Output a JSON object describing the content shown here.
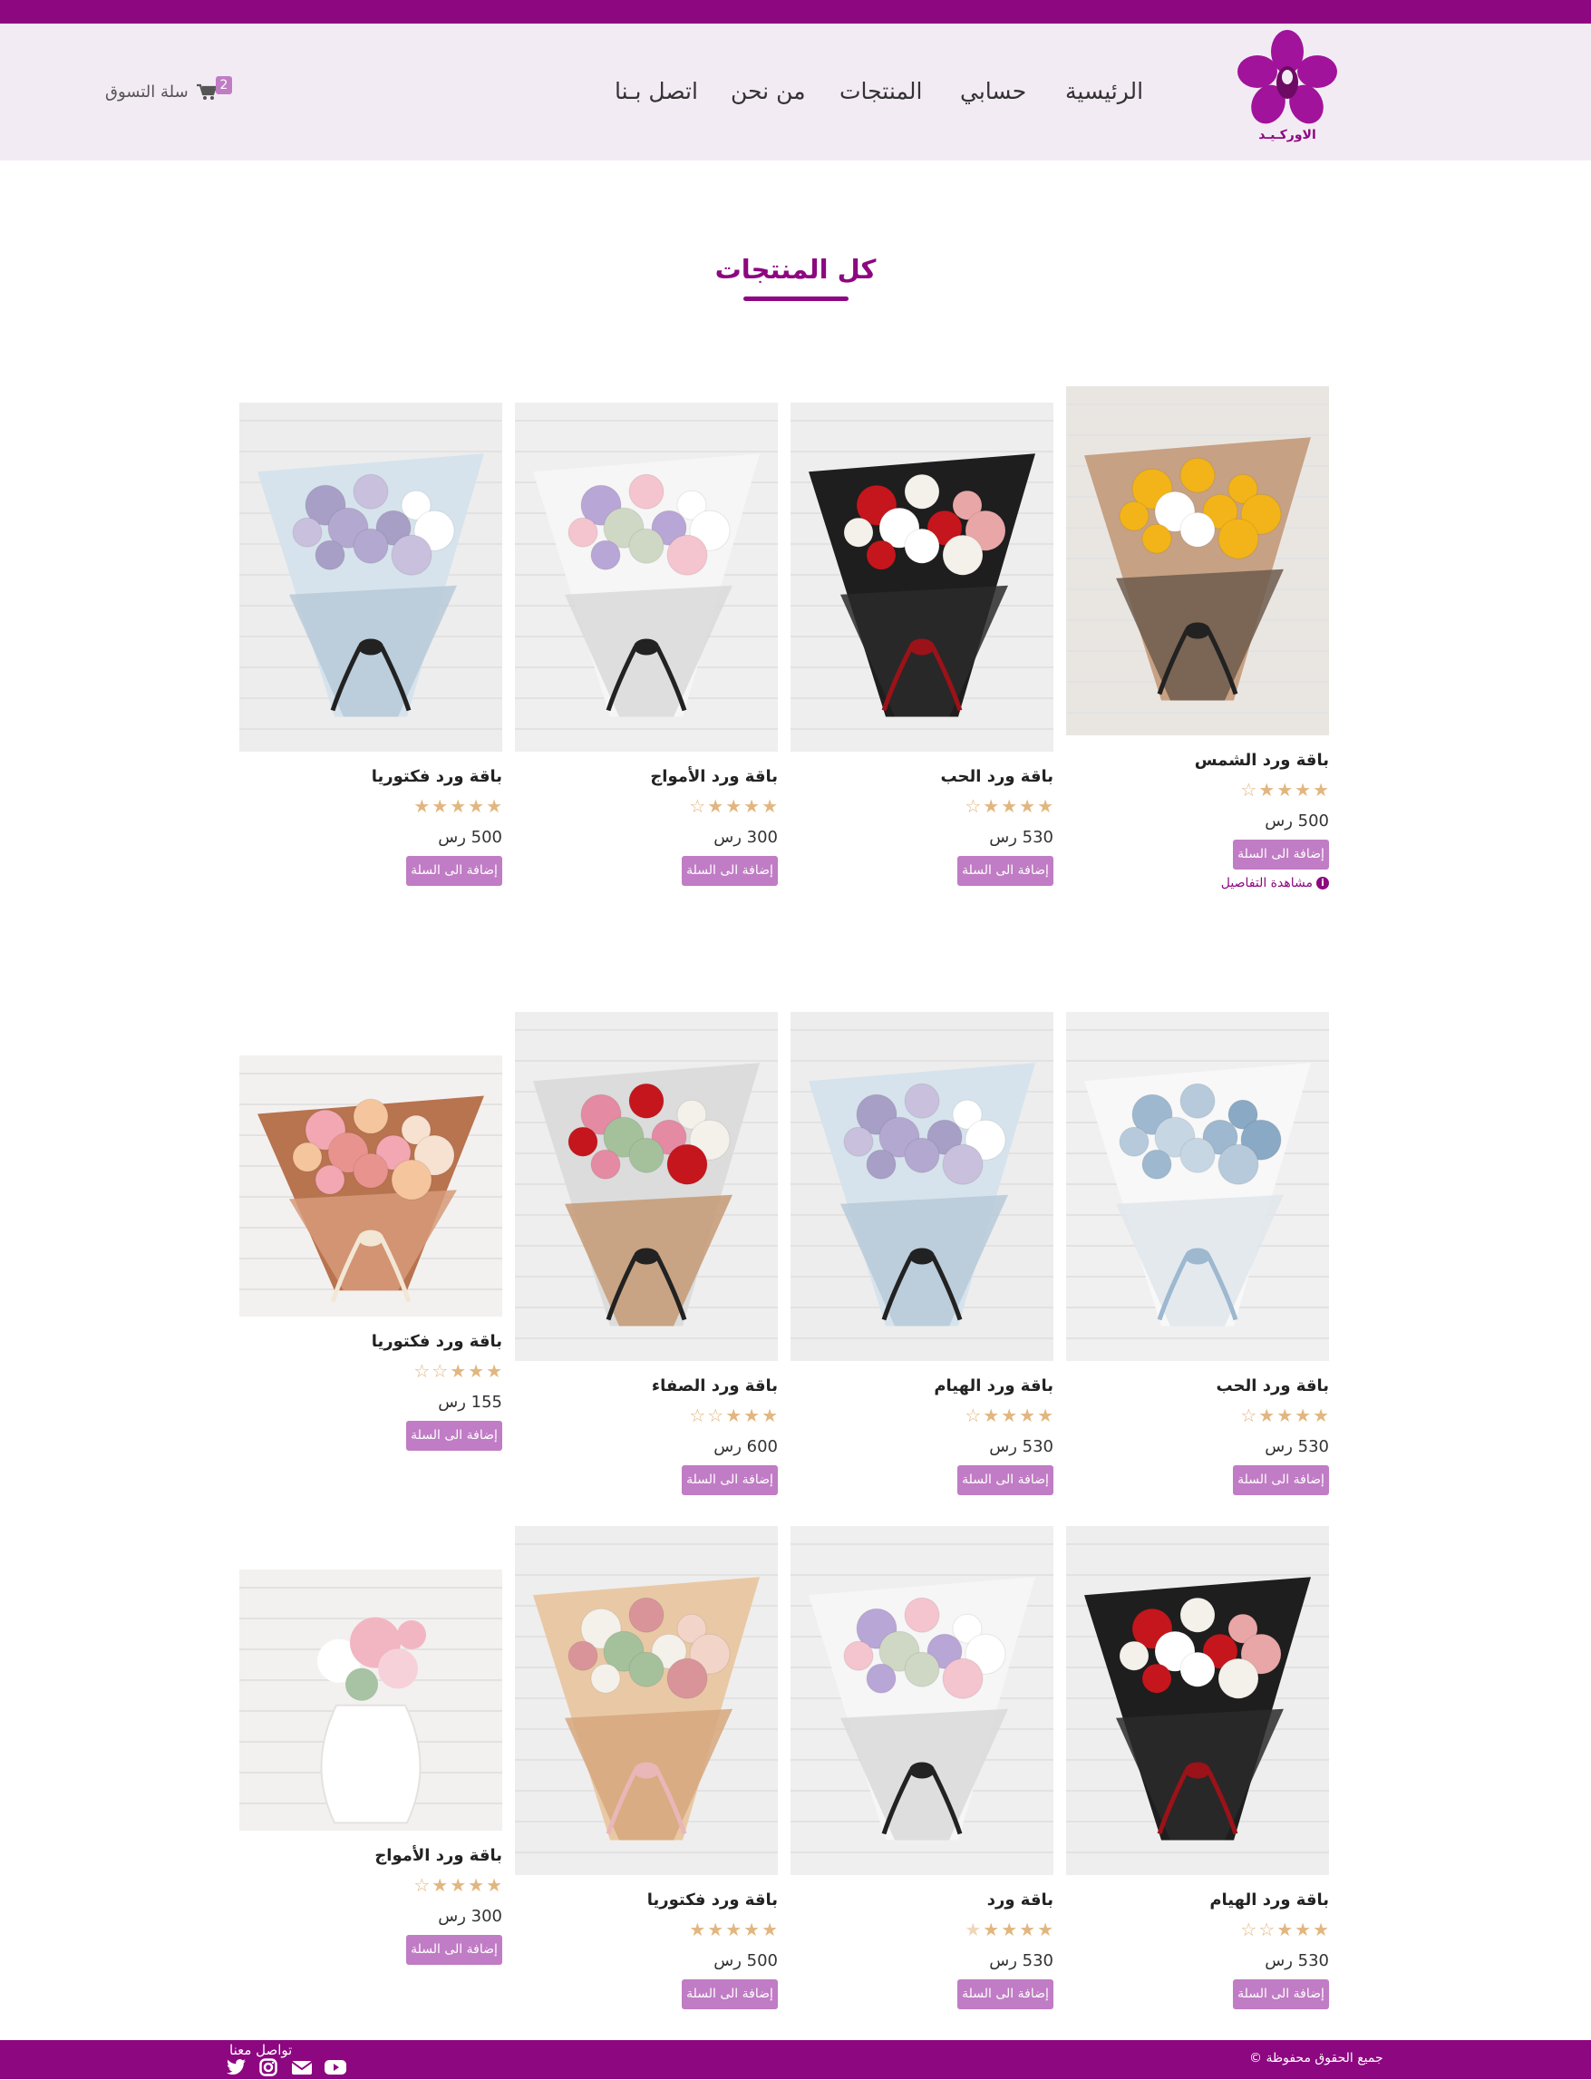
{
  "brand": {
    "logo_text": "الاوركـيـد"
  },
  "nav": {
    "home": "الرئيسية",
    "account": "حسابي",
    "products": "المنتجات",
    "about": "من نحن",
    "contact": "اتصل بـنا"
  },
  "cart": {
    "label": "سلة التسوق",
    "count": "2"
  },
  "page": {
    "title": "كل المنتجات"
  },
  "colors": {
    "brand": "#8d0780",
    "button": "#c07cc4",
    "star": "#e2b67f",
    "header_bg": "#f3ebf4"
  },
  "products": [
    {
      "name": "باقة ورد الشمس",
      "rating": 4,
      "price": "500 رس",
      "add_label": "إضافة الى السلة",
      "details_label": "مشاهدة التفاصيل",
      "photo": "sunflower-bouquet"
    },
    {
      "name": "باقة ورد الحب",
      "rating": 4,
      "price": "530 رس",
      "add_label": "إضافة الى السلة",
      "photo": "black-wrap-bouquet"
    },
    {
      "name": "باقة ورد الأمواج",
      "rating": 4,
      "price": "300 رس",
      "add_label": "إضافة الى السلة",
      "photo": "white-wrap-bouquet"
    },
    {
      "name": "باقة ورد فكتوريا",
      "rating": 5,
      "price": "500 رس",
      "add_label": "إضافة الى السلة",
      "photo": "lilac-bouquet"
    },
    {
      "name": "باقة ورد الحب",
      "rating": 4,
      "price": "530 رس",
      "add_label": "إضافة الى السلة",
      "photo": "blue-gypsophila-bouquet"
    },
    {
      "name": "باقة ورد الهيام",
      "rating": 4,
      "price": "530 رس",
      "add_label": "إضافة الى السلة",
      "photo": "lilac-bouquet"
    },
    {
      "name": "باقة ورد الصفاء",
      "rating": 3,
      "price": "600 رس",
      "add_label": "إضافة الى السلة",
      "photo": "mixed-roses-bouquet"
    },
    {
      "name": "باقة ورد فكتوريا",
      "rating": 3,
      "price": "155 رس",
      "add_label": "إضافة الى السلة",
      "photo": "peach-roses-bouquet"
    },
    {
      "name": "باقة ورد الهيام",
      "rating": 3,
      "price": "530 رس",
      "add_label": "إضافة الى السلة",
      "photo": "black-wrap-bouquet"
    },
    {
      "name": "باقة ورد",
      "rating": 4.5,
      "price": "530 رس",
      "add_label": "إضافة الى السلة",
      "photo": "white-wrap-bouquet"
    },
    {
      "name": "باقة ورد فكتوريا",
      "rating": 5,
      "price": "500 رس",
      "add_label": "إضافة الى السلة",
      "photo": "kraft-wrap-bouquet"
    },
    {
      "name": "باقة ورد الأمواج",
      "rating": 4,
      "price": "300 رس",
      "add_label": "إضافة الى السلة",
      "photo": "vase-arrangement"
    }
  ],
  "footer": {
    "copyright": "جميع الحقوق محفوظة ©",
    "contact_label": "تواصل معنا",
    "socials": [
      "youtube-icon",
      "envelope-icon",
      "instagram-icon",
      "twitter-icon"
    ]
  }
}
